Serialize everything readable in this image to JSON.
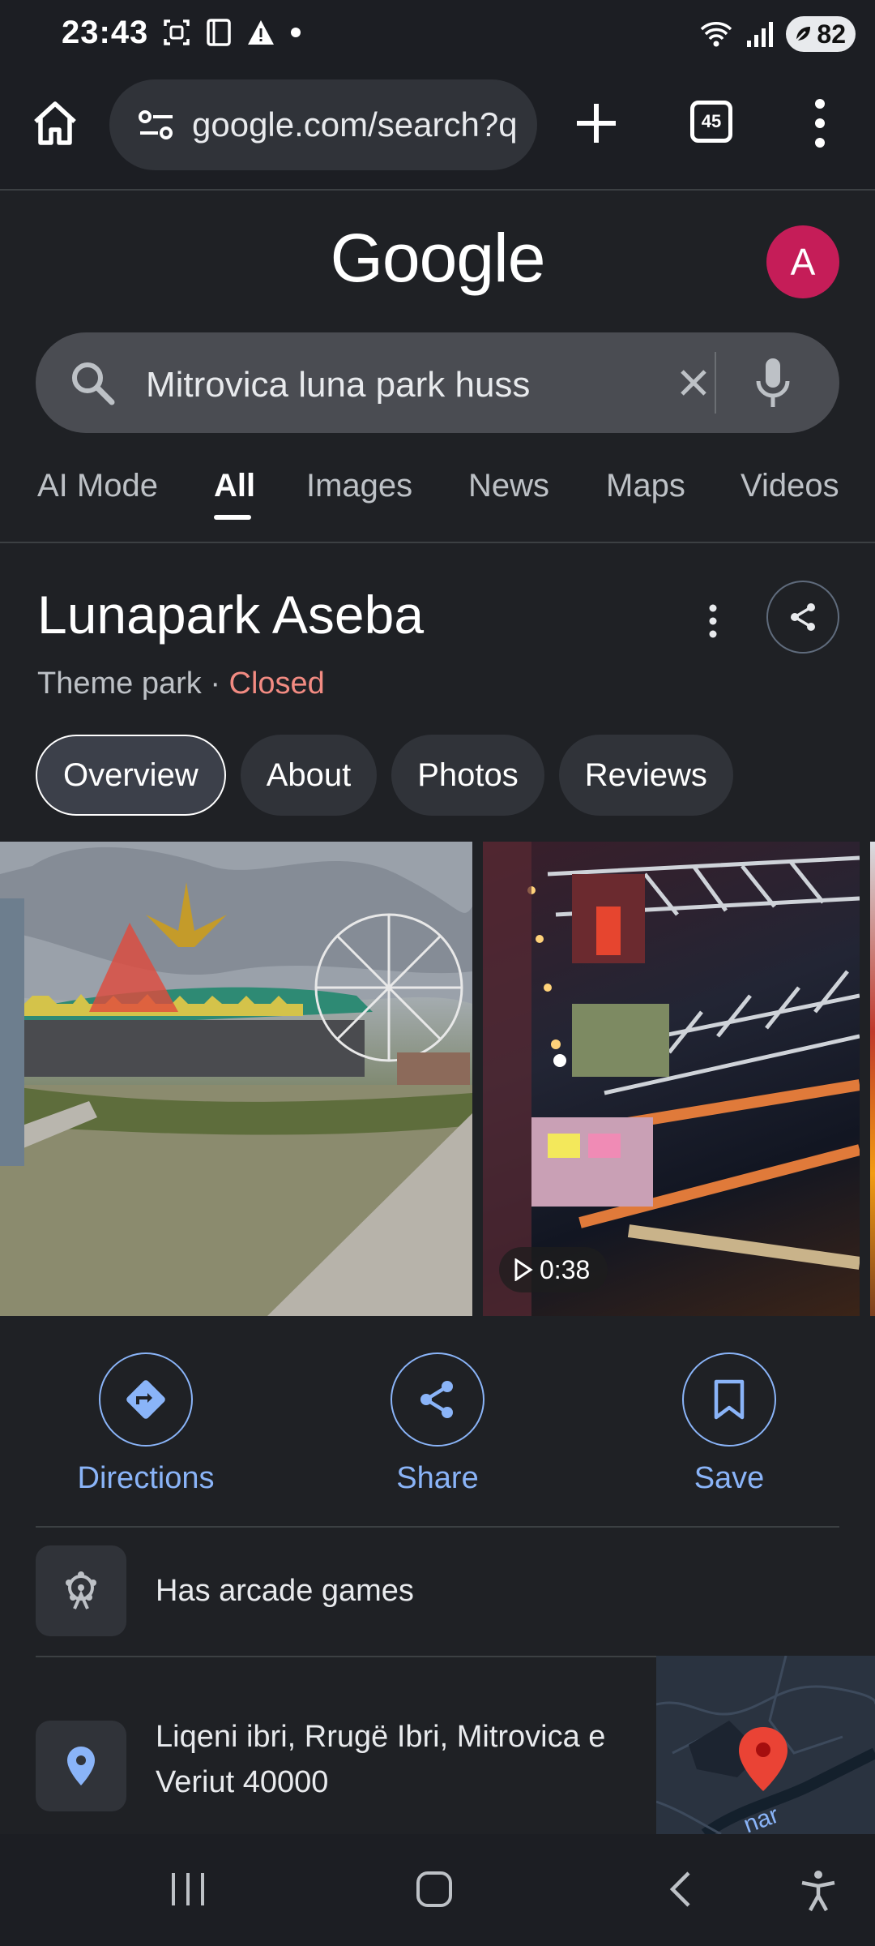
{
  "status_bar": {
    "time": "23:43",
    "battery": "82",
    "icons_left": [
      "screenshot-icon",
      "tablet-icon",
      "warning-icon",
      "dot-icon"
    ],
    "icons_right": [
      "wifi-icon",
      "signal-icon",
      "battery-icon"
    ]
  },
  "browser": {
    "url": "google.com/search?q",
    "tab_count": "45"
  },
  "google": {
    "logo": "Google",
    "avatar_letter": "A"
  },
  "search": {
    "query": "Mitrovica luna park huss"
  },
  "search_tabs": [
    {
      "label": "AI Mode",
      "active": false
    },
    {
      "label": "All",
      "active": true
    },
    {
      "label": "Images",
      "active": false
    },
    {
      "label": "News",
      "active": false
    },
    {
      "label": "Maps",
      "active": false
    },
    {
      "label": "Videos",
      "active": false
    }
  ],
  "place": {
    "title": "Lunapark Aseba",
    "category": "Theme park",
    "separator": "·",
    "status": "Closed"
  },
  "chips": [
    "Overview",
    "About",
    "Photos",
    "Reviews"
  ],
  "media": {
    "video_duration": "0:38"
  },
  "actions": {
    "directions": "Directions",
    "share": "Share",
    "save": "Save"
  },
  "info": {
    "amenity": "Has arcade games",
    "address_line1": "Liqeni ibri, Rrugë Ibri, Mitrovica e",
    "address_line2": "Veriut 40000"
  },
  "map": {
    "label": "nar"
  },
  "colors": {
    "accent": "#8ab4f8",
    "closed": "#f28b82",
    "avatar": "#c51d58",
    "background": "#1f2125"
  }
}
